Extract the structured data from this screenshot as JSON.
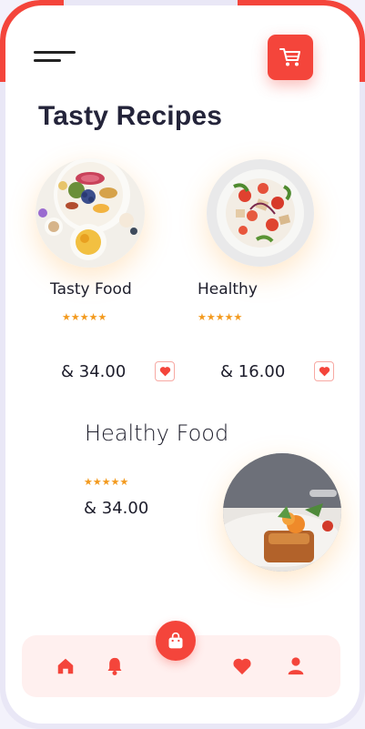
{
  "header": {
    "title": "Tasty Recipes",
    "menu_icon": "hamburger-menu-icon",
    "cart_icon": "cart-icon"
  },
  "cards": [
    {
      "name": "Tasty Food",
      "rating": "★★★★★",
      "price": "& 34.00",
      "fav_icon": "heart-icon"
    },
    {
      "name": "Healthy",
      "rating": "★★★★★",
      "price": "& 16.00",
      "fav_icon": "heart-icon"
    }
  ],
  "featured": {
    "name": "Healthy Food",
    "rating": "★★★★★",
    "price": "& 34.00"
  },
  "nav": {
    "items": [
      "home-icon",
      "bell-icon",
      "bag-icon",
      "heart-icon",
      "user-icon"
    ],
    "active": "bag-icon"
  },
  "colors": {
    "accent": "#f4453b",
    "star": "#f39a1e",
    "text": "#1d1d2b",
    "nav_bg": "#fff0ef"
  }
}
